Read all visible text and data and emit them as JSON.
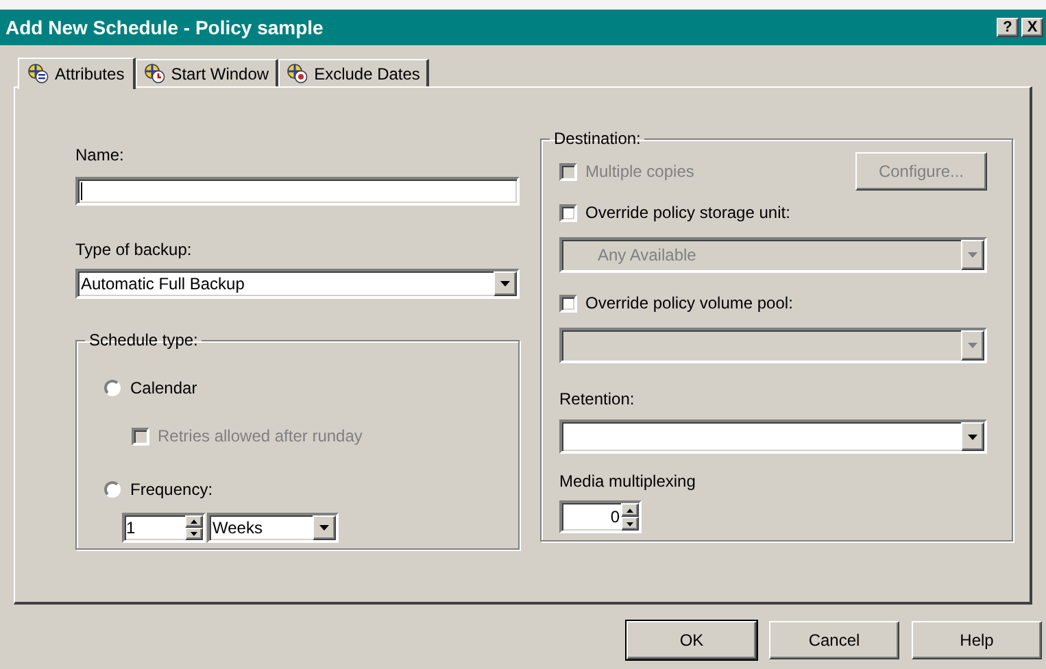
{
  "window": {
    "title": "Add New Schedule - Policy sample",
    "controls": [
      "?",
      "X"
    ]
  },
  "tabs": [
    {
      "label": "Attributes",
      "selected": true
    },
    {
      "label": "Start Window",
      "selected": false
    },
    {
      "label": "Exclude Dates",
      "selected": false
    }
  ],
  "name": {
    "label": "Name:"
  },
  "type_of_backup": {
    "label": "Type of backup:",
    "value": "Automatic Full Backup"
  },
  "schedule_type": {
    "legend": "Schedule type:",
    "options": [
      {
        "kind": "radio",
        "label": "Calendar",
        "selected": false
      },
      {
        "kind": "checkbox",
        "label": "Retries allowed after runday",
        "checked": false,
        "disabled": true
      },
      {
        "kind": "radio",
        "label": "Frequency:",
        "selected": false
      }
    ],
    "frequency": {
      "value": "1",
      "unit": "Weeks"
    }
  },
  "destination": {
    "legend": "Destination:",
    "multiple_copies": {
      "label": "Multiple copies",
      "checked": false,
      "disabled": true
    },
    "configure_button": {
      "label": "Configure...",
      "disabled": true
    },
    "storage_unit": {
      "label": "Override policy storage unit:",
      "checked": false,
      "value": "Any Available",
      "disabled": true
    },
    "volume_pool": {
      "label": "Override policy volume pool:",
      "checked": false,
      "disabled": true
    },
    "retention": {
      "label": "Retention:"
    },
    "media_multiplexing": {
      "label": "Media multiplexing",
      "value": "0"
    }
  },
  "buttons": [
    {
      "label": "OK",
      "default": true
    },
    {
      "label": "Cancel",
      "default": false
    },
    {
      "label": "Help",
      "default": false
    }
  ]
}
